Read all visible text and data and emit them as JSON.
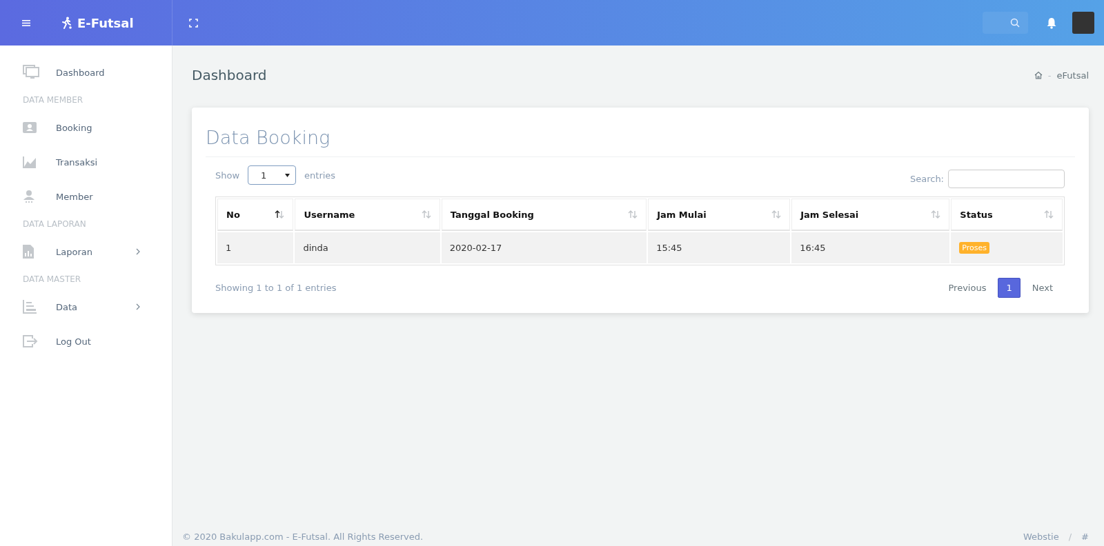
{
  "brand": {
    "name": "E-Futsal"
  },
  "sidebar": {
    "items": [
      {
        "kind": "item",
        "label": "Dashboard",
        "has_children": false
      },
      {
        "kind": "heading",
        "label": "DATA MEMBER"
      },
      {
        "kind": "item",
        "label": "Booking",
        "has_children": false
      },
      {
        "kind": "item",
        "label": "Transaksi",
        "has_children": false
      },
      {
        "kind": "item",
        "label": "Member",
        "has_children": false
      },
      {
        "kind": "heading",
        "label": "DATA LAPORAN"
      },
      {
        "kind": "item",
        "label": "Laporan",
        "has_children": true
      },
      {
        "kind": "heading",
        "label": "DATA MASTER"
      },
      {
        "kind": "item",
        "label": "Data",
        "has_children": true
      },
      {
        "kind": "item",
        "label": "Log Out",
        "has_children": false
      }
    ]
  },
  "page": {
    "title": "Dashboard",
    "breadcrumb": {
      "separator": "-",
      "current": "eFutsal"
    }
  },
  "card": {
    "title": "Data Booking",
    "length": {
      "label_before": "Show",
      "value": "1",
      "label_after": "entries"
    },
    "search": {
      "label": "Search:"
    },
    "table": {
      "columns": [
        {
          "label": "No",
          "sorted": true
        },
        {
          "label": "Username",
          "sorted": false
        },
        {
          "label": "Tanggal Booking",
          "sorted": false
        },
        {
          "label": "Jam Mulai",
          "sorted": false
        },
        {
          "label": "Jam Selesai",
          "sorted": false
        },
        {
          "label": "Status",
          "sorted": false
        }
      ],
      "rows": [
        {
          "no": "1",
          "username": "dinda",
          "date": "2020-02-17",
          "start": "15:45",
          "end": "16:45",
          "status": "Proses",
          "color": "#ffb22b"
        }
      ]
    },
    "info": "Showing 1 to 1 of 1 entries",
    "pagination": [
      {
        "label": "Previous",
        "selected": false
      },
      {
        "label": "1",
        "selected": true
      },
      {
        "label": "Next",
        "selected": false
      }
    ]
  },
  "footer": {
    "copyright": "© 2020 Bakulapp.com - E-Futsal. All Rights Reserved.",
    "links": [
      {
        "label": "Webstie"
      },
      {
        "label": "#"
      }
    ],
    "separator": "/"
  }
}
